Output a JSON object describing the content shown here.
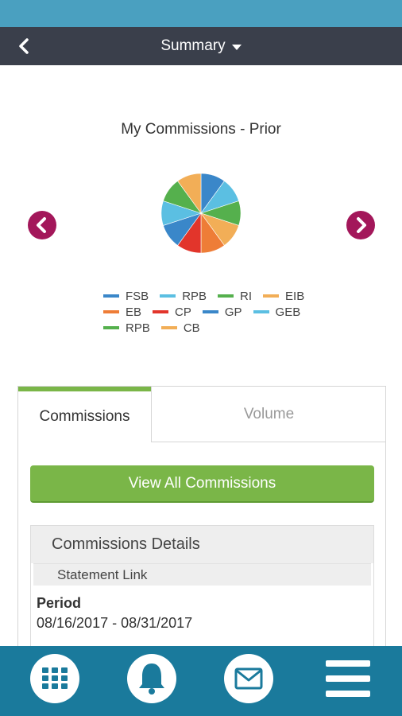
{
  "header": {
    "title": "Summary",
    "back_icon": "chevron-left-icon",
    "dropdown_icon": "caret-down-icon"
  },
  "chart_data": {
    "type": "pie",
    "title": "My Commissions - Prior",
    "series": [
      {
        "name": "FSB",
        "color": "#3a87c9",
        "value": 1
      },
      {
        "name": "RPB",
        "color": "#5bbfe2",
        "value": 1
      },
      {
        "name": "RI",
        "color": "#55b04d",
        "value": 1
      },
      {
        "name": "EIB",
        "color": "#f2ae57",
        "value": 1
      },
      {
        "name": "EB",
        "color": "#ee7d37",
        "value": 1
      },
      {
        "name": "CP",
        "color": "#e2352b",
        "value": 1
      },
      {
        "name": "GP",
        "color": "#3a87c9",
        "value": 1
      },
      {
        "name": "GEB",
        "color": "#5bbfe2",
        "value": 1
      },
      {
        "name": "RPB",
        "color": "#55b04d",
        "value": 1
      },
      {
        "name": "CB",
        "color": "#f2ae57",
        "value": 1
      }
    ],
    "legend_placement": "bottom"
  },
  "carousel": {
    "prev_icon": "chevron-left-circle-icon",
    "next_icon": "chevron-right-circle-icon",
    "accent": "#a3175a"
  },
  "tabs": [
    {
      "label": "Commissions",
      "active": true
    },
    {
      "label": "Volume",
      "active": false
    }
  ],
  "actions": {
    "view_all_label": "View All Commissions"
  },
  "details": {
    "heading": "Commissions Details",
    "statement_link": "Statement Link",
    "period_label": "Period",
    "period_value": "08/16/2017 - 08/31/2017"
  },
  "bottom_nav": {
    "items": [
      "grid-icon",
      "bell-icon",
      "mail-icon",
      "menu-icon"
    ]
  },
  "colors": {
    "accent_green": "#7ab648",
    "nav_dark": "#3a3f4b",
    "status_blue": "#4aa0c0",
    "bottom_bar": "#1a7a9c"
  }
}
